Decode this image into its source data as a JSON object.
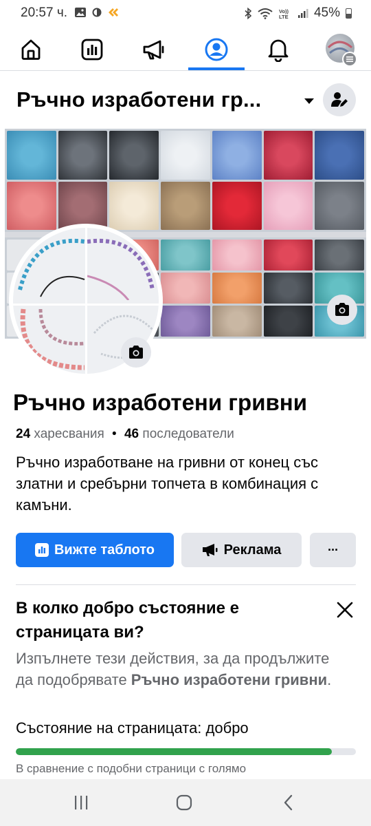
{
  "status_bar": {
    "time": "20:57 ч.",
    "battery": "45%",
    "network": "VoLTE"
  },
  "nav": {
    "tabs": [
      "home",
      "dashboard",
      "ads",
      "profile",
      "notifications",
      "avatar"
    ],
    "active": "profile",
    "accent": "#1877f2"
  },
  "header": {
    "title": "Ръчно изработени гр..."
  },
  "profile": {
    "name": "Ръчно изработени гривни",
    "likes_count": "24",
    "likes_label": "харесвания",
    "followers_count": "46",
    "followers_label": "последователи",
    "separator": "•",
    "bio": "Ръчно изработване на гривни от конец със златни и сребърни топчета в комбинация с камъни."
  },
  "actions": {
    "dashboard_label": "Вижте таблото",
    "ad_label": "Реклама",
    "more_label": "···"
  },
  "health": {
    "title": "В колко добро състояние е страницата ви?",
    "desc_prefix": "Изпълнете тези действия, за да продължите да подобрявате ",
    "desc_page": "Ръчно изработени гривни",
    "desc_suffix": ".",
    "status": "Състояние на страницата: добро",
    "progress": 0.93,
    "progress_color": "#31a24c",
    "compare_text": "В сравнение с подобни страници с голямо"
  },
  "icons": {
    "home": "home-icon",
    "dashboard": "dashboard-icon",
    "ads": "megaphone-icon",
    "profile": "profile-icon",
    "notifications": "bell-icon",
    "camera": "camera-icon",
    "close": "close-icon",
    "edit_profile": "user-edit-icon"
  }
}
